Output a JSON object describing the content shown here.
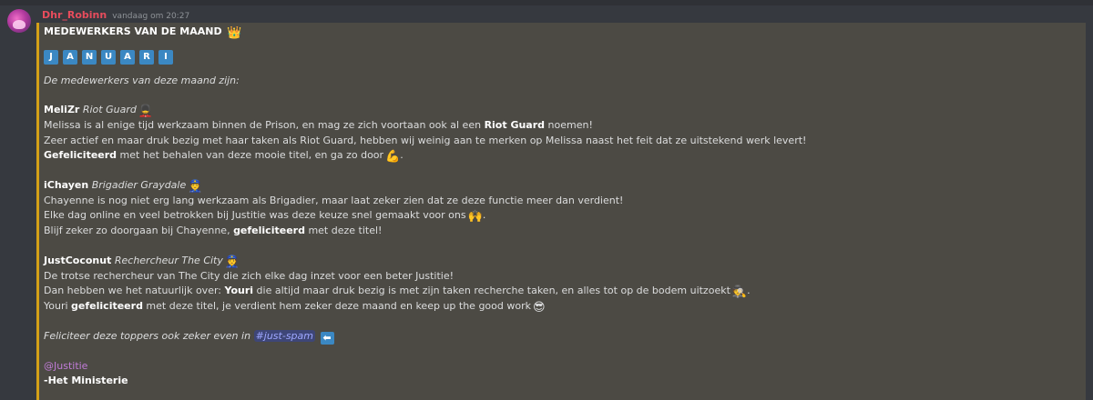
{
  "message": {
    "username": "Dhr_Robinn",
    "timestamp": "vandaag om 20:27"
  },
  "embed": {
    "title": "MEDEWERKERS VAN DE MAAND",
    "title_emoji": "👑",
    "month_letters": [
      "J",
      "A",
      "N",
      "U",
      "A",
      "R",
      "I"
    ],
    "intro": "De medewerkers van deze maand zijn:",
    "blocks": [
      {
        "name": "MeliZr",
        "role": "Riot Guard",
        "role_emoji": "💂",
        "lines": {
          "l1_a": "Melissa is al enige tijd werkzaam binnen de Prison, en mag ze zich voortaan ook al een ",
          "l1_b": "Riot Guard",
          "l1_c": " noemen!",
          "l2": "Zeer actief en maar druk bezig met haar taken als Riot Guard, hebben wij weinig aan te merken op Melissa naast het feit dat ze uitstekend werk levert!",
          "l3_a": "Gefeliciteerd",
          "l3_b": " met het behalen van deze mooie titel, en ga zo door",
          "l3_emoji": "💪",
          "l3_c": "."
        }
      },
      {
        "name": "iChayen",
        "role": "Brigadier Graydale",
        "role_emoji": "👮",
        "lines": {
          "l1": "Chayenne is nog niet erg lang werkzaam als Brigadier, maar laat zeker zien dat ze deze functie meer dan verdient!",
          "l2_a": "Elke dag online en veel betrokken bij Justitie was deze keuze snel gemaakt voor ons",
          "l2_emoji": "🙌",
          "l2_b": ".",
          "l3_a": "Blijf zeker zo doorgaan bij Chayenne, ",
          "l3_b": "gefeliciteerd",
          "l3_c": " met deze titel!"
        }
      },
      {
        "name": "JustCoconut",
        "role": "Rechercheur The City",
        "role_emoji": "👮",
        "lines": {
          "l1": "De trotse rechercheur van The City die zich elke dag inzet voor een beter Justitie!",
          "l2_a": "Dan hebben we het natuurlijk over: ",
          "l2_b": "Youri",
          "l2_c": " die altijd maar druk bezig is met zijn taken recherche taken, en alles tot op de bodem uitzoekt",
          "l2_emoji": "🕵",
          "l2_d": ".",
          "l3_a": "Youri ",
          "l3_b": "gefeliciteerd",
          "l3_c": " met deze titel, je verdient hem zeker deze maand en keep up the good work",
          "l3_emoji": "😎"
        }
      }
    ],
    "closing_text": "Feliciteer deze toppers ook zeker even in ",
    "closing_channel": "#just-spam",
    "closing_arrow": "⬅",
    "mention": "@Justitie",
    "signature": "-Het Ministerie"
  },
  "colors": {
    "background": "#36393f",
    "embed_bg": "#4c4a44",
    "embed_border": "#d4a017",
    "username": "#e74c5c",
    "letter_box": "#3b88c3",
    "mention": "#c17cd8"
  }
}
